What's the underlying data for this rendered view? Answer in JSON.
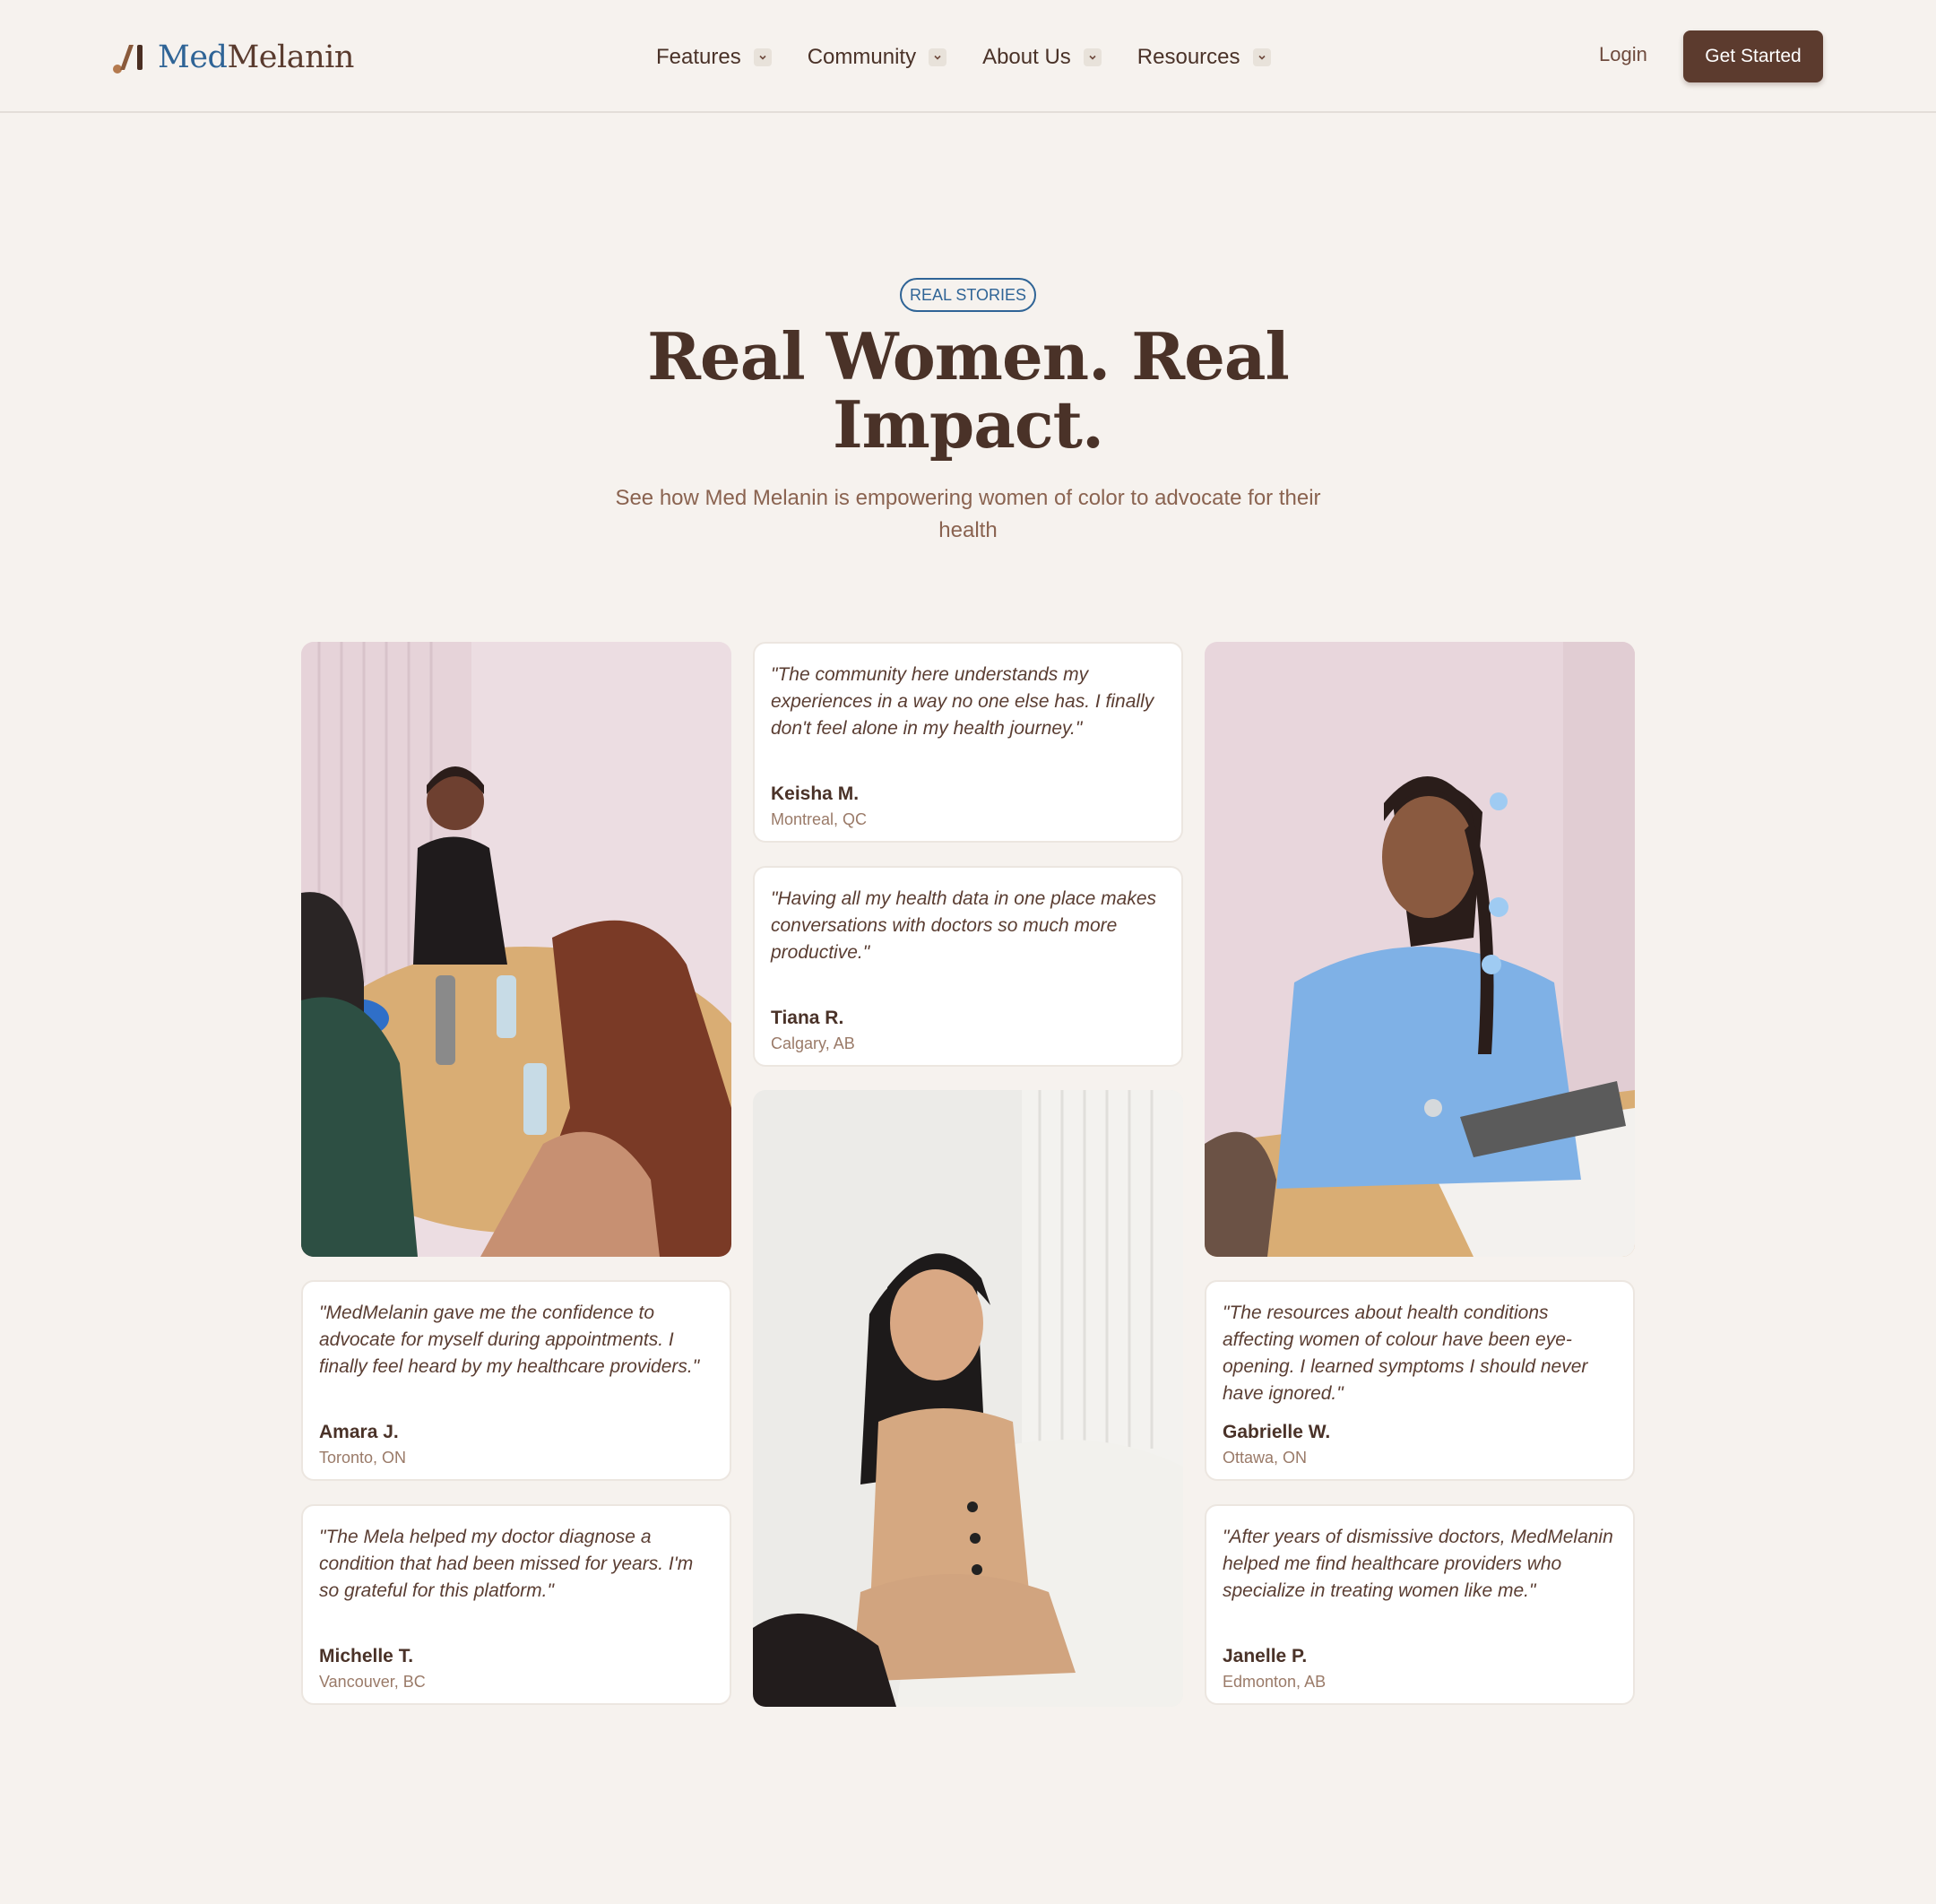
{
  "brand": {
    "name_part1": "Med",
    "name_part2": "Melanin",
    "accent": "#2f6496",
    "primary": "#5c3b2e"
  },
  "nav": {
    "items": [
      {
        "label": "Features"
      },
      {
        "label": "Community"
      },
      {
        "label": "About Us"
      },
      {
        "label": "Resources"
      }
    ],
    "chevron_icon": "chevron-down-icon",
    "login_label": "Login",
    "cta_label": "Get Started"
  },
  "hero": {
    "badge": "REAL STORIES",
    "title": "Real Women. Real Impact.",
    "subtitle": "See how Med Melanin is empowering women of color to advocate for their health"
  },
  "testimonials": [
    {
      "quote": "\"The community here understands my experiences in a way no one else has. I finally don't feel alone in my health journey.\"",
      "name": "Keisha M.",
      "location": "Montreal, QC"
    },
    {
      "quote": "\"Having all my health data in one place makes conversations with doctors so much more productive.\"",
      "name": "Tiana R.",
      "location": "Calgary, AB"
    },
    {
      "quote": "\"MedMelanin gave me the confidence to advocate for myself during appointments. I finally feel heard by my healthcare providers.\"",
      "name": "Amara J.",
      "location": "Toronto, ON"
    },
    {
      "quote": "\"The Mela helped my doctor diagnose a condition that had been missed for years. I'm so grateful for this platform.\"",
      "name": "Michelle T.",
      "location": "Vancouver, BC"
    },
    {
      "quote": "\"The resources about health conditions affecting women of colour have been eye-opening. I learned symptoms I should never have ignored.\"",
      "name": "Gabrielle W.",
      "location": "Ottawa, ON"
    },
    {
      "quote": "\"After years of dismissive doctors, MedMelanin helped me find healthcare providers who specialize in treating women like me.\"",
      "name": "Janelle P.",
      "location": "Edmonton, AB"
    }
  ]
}
